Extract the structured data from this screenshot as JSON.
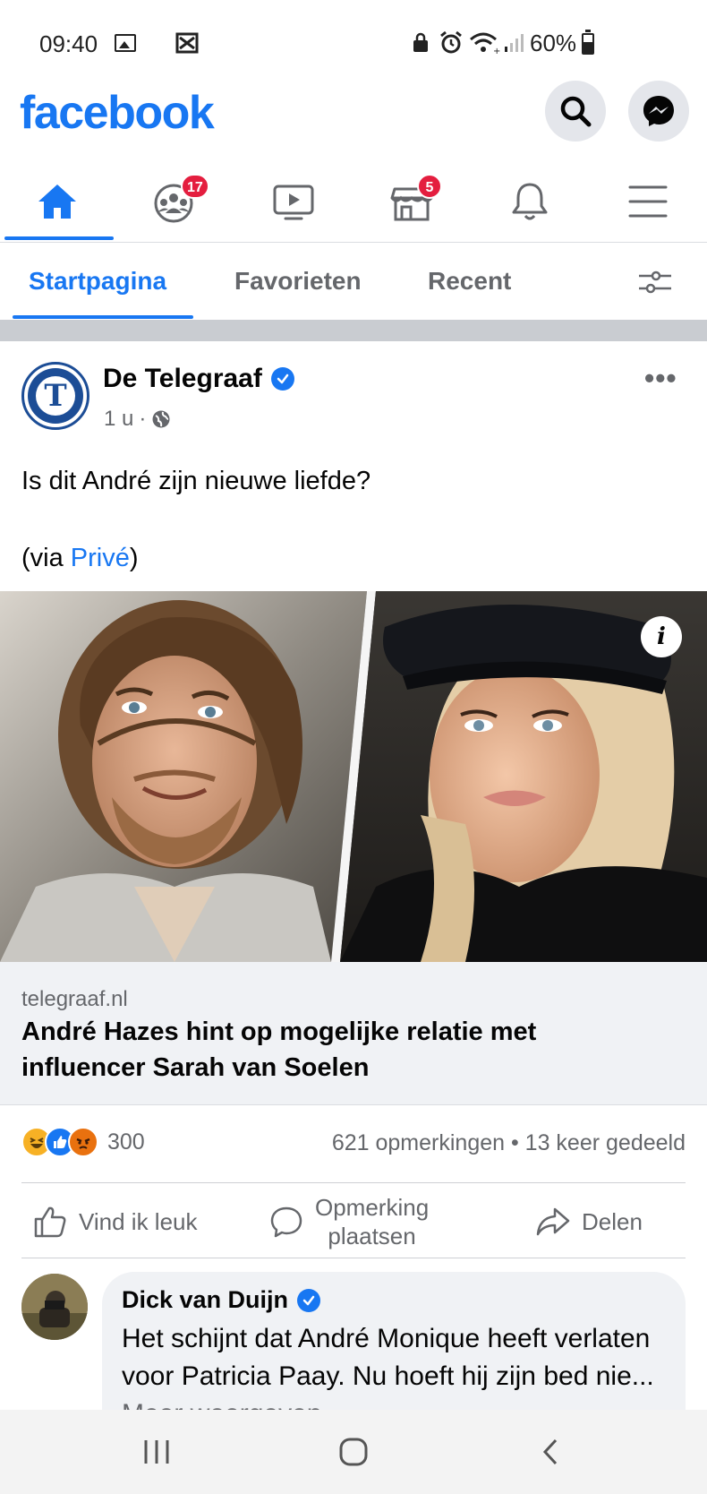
{
  "status_bar": {
    "time": "09:40",
    "battery": "60%"
  },
  "header": {
    "logo": "facebook",
    "search_icon": "search-icon",
    "messenger_icon": "messenger-icon"
  },
  "nav": {
    "items": [
      {
        "icon": "home-icon",
        "badge": ""
      },
      {
        "icon": "groups-icon",
        "badge": "17"
      },
      {
        "icon": "watch-icon",
        "badge": ""
      },
      {
        "icon": "marketplace-icon",
        "badge": "5"
      },
      {
        "icon": "bell-icon",
        "badge": ""
      },
      {
        "icon": "menu-icon",
        "badge": ""
      }
    ]
  },
  "feed_tabs": {
    "tabs": [
      "Startpagina",
      "Favorieten",
      "Recent"
    ],
    "active": "Startpagina"
  },
  "post": {
    "author": "De Telegraaf",
    "avatar_letter": "T",
    "time": "1 u",
    "text_line1": "Is dit André zijn nieuwe liefde?",
    "text_prefix": "(via ",
    "text_link": "Privé",
    "text_suffix": ")",
    "link": {
      "domain": "telegraaf.nl",
      "title": "André Hazes hint op mogelijke relatie met influencer Sarah van Soelen"
    },
    "reaction_count": "300",
    "stats": "621 opmerkingen • 13 keer gedeeld",
    "actions": {
      "like": "Vind ik leuk",
      "comment_line1": "Opmerking",
      "comment_line2": "plaatsen",
      "share": "Delen"
    }
  },
  "comment": {
    "author": "Dick van Duijn",
    "text": "Het schijnt dat André Monique heeft verlaten voor Patricia Paay. Nu hoeft hij zijn bed nie... ",
    "more": "Meer weergeven"
  },
  "colors": {
    "brand": "#1877f2",
    "badge": "#e41e3f",
    "secondary_text": "#65676b"
  }
}
